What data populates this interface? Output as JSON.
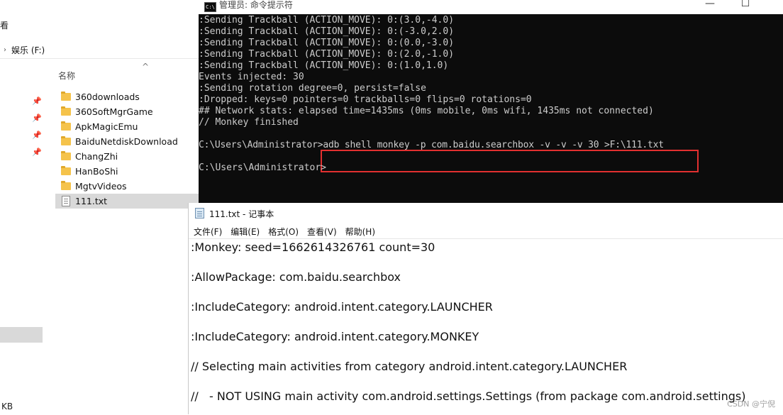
{
  "explorer": {
    "ribbon_fragment": "看",
    "address": "娱乐 (F:)",
    "column_header": "名称",
    "status_fragment": "KB",
    "files": [
      {
        "name": "360downloads",
        "type": "folder"
      },
      {
        "name": "360SoftMgrGame",
        "type": "folder"
      },
      {
        "name": "ApkMagicEmu",
        "type": "folder"
      },
      {
        "name": "BaiduNetdiskDownload",
        "type": "folder"
      },
      {
        "name": "ChangZhi",
        "type": "folder"
      },
      {
        "name": "HanBoShi",
        "type": "folder"
      },
      {
        "name": "MgtvVideos",
        "type": "folder"
      },
      {
        "name": "111.txt",
        "type": "text",
        "selected": true
      }
    ]
  },
  "console": {
    "title": "管理员: 命令提示符",
    "icon_label": "C:\\",
    "lines": [
      ":Sending Trackball (ACTION_MOVE): 0:(3.0,-4.0)",
      ":Sending Trackball (ACTION_MOVE): 0:(-3.0,2.0)",
      ":Sending Trackball (ACTION_MOVE): 0:(0.0,-3.0)",
      ":Sending Trackball (ACTION_MOVE): 0:(2.0,-1.0)",
      ":Sending Trackball (ACTION_MOVE): 0:(1.0,1.0)",
      "Events injected: 30",
      ":Sending rotation degree=0, persist=false",
      ":Dropped: keys=0 pointers=0 trackballs=0 flips=0 rotations=0",
      "## Network stats: elapsed time=1435ms (0ms mobile, 0ms wifi, 1435ms not connected)",
      "// Monkey finished",
      "",
      "C:\\Users\\Administrator>adb shell monkey -p com.baidu.searchbox -v -v -v 30 >F:\\111.txt",
      "",
      "C:\\Users\\Administrator>"
    ],
    "window_buttons": {
      "minimize": "—",
      "maximize": "☐",
      "close": "✕"
    }
  },
  "notepad": {
    "title": "111.txt - 记事本",
    "menu": [
      "文件(F)",
      "编辑(E)",
      "格式(O)",
      "查看(V)",
      "帮助(H)"
    ],
    "lines": [
      ":Monkey: seed=1662614326761 count=30",
      ":AllowPackage: com.baidu.searchbox",
      ":IncludeCategory: android.intent.category.LAUNCHER",
      ":IncludeCategory: android.intent.category.MONKEY",
      "// Selecting main activities from category android.intent.category.LAUNCHER",
      "//   - NOT USING main activity com.android.settings.Settings (from package com.android.settings)"
    ]
  },
  "watermark": "CSDN @宁倪"
}
